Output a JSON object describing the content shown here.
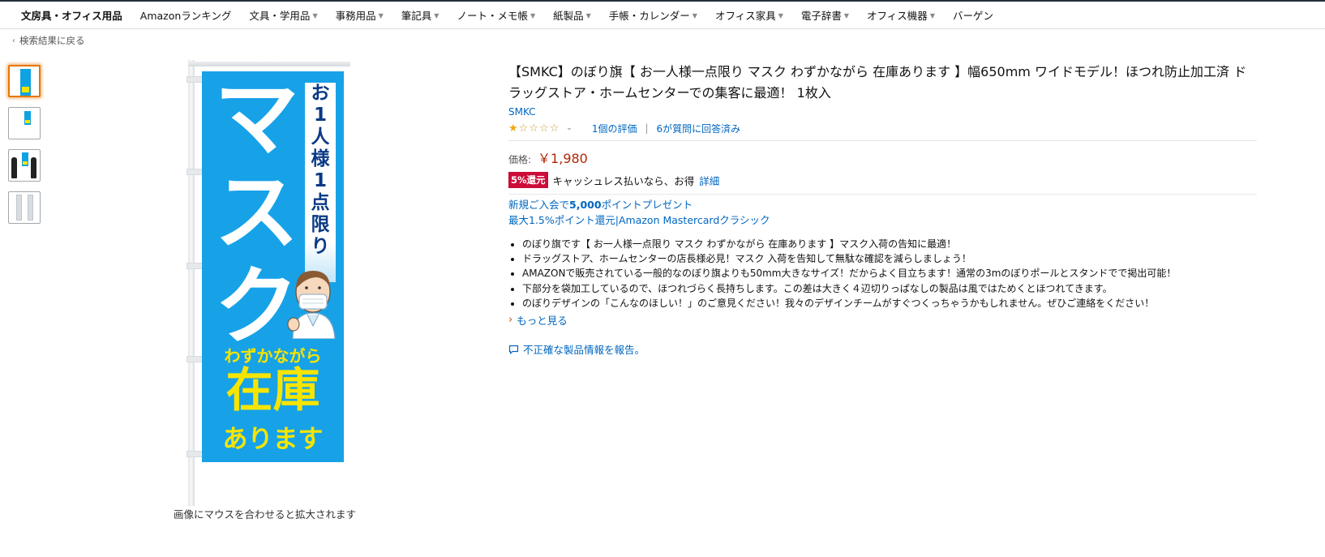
{
  "nav": {
    "items": [
      {
        "label": "文房具・オフィス用品",
        "dropdown": false,
        "bold": true
      },
      {
        "label": "Amazonランキング",
        "dropdown": false
      },
      {
        "label": "文具・学用品",
        "dropdown": true
      },
      {
        "label": "事務用品",
        "dropdown": true
      },
      {
        "label": "筆記具",
        "dropdown": true
      },
      {
        "label": "ノート・メモ帳",
        "dropdown": true
      },
      {
        "label": "紙製品",
        "dropdown": true
      },
      {
        "label": "手帳・カレンダー",
        "dropdown": true
      },
      {
        "label": "オフィス家具",
        "dropdown": true
      },
      {
        "label": "電子辞書",
        "dropdown": true
      },
      {
        "label": "オフィス機器",
        "dropdown": true
      },
      {
        "label": "バーゲン",
        "dropdown": false
      }
    ]
  },
  "back_link": "検索結果に戻る",
  "image": {
    "main_text": "マスク",
    "sub_text": "お1人様1点限り",
    "line1": "わずかながら",
    "line2": "在庫",
    "line3": "あります",
    "hover_hint": "画像にマウスを合わせると拡大されます"
  },
  "product": {
    "title": "【SMKC】のぼり旗【 お一人様一点限り マスク わずかながら 在庫あります 】幅650mm ワイドモデル！ほつれ防止加工済 ドラッグストア・ホームセンターでの集客に最適！ 1枚入",
    "brand": "SMKC",
    "rating_stars": 1,
    "rating_count": "1個の評価",
    "answered": "6が質問に回答済み",
    "price_label": "価格:",
    "price": "￥1,980",
    "promo_badge": "5%還元",
    "promo_text": "キャッシュレス払いなら、お得",
    "promo_link": "詳細",
    "points_line1_pre": "新規ご入会で",
    "points_line1_bold": "5,000",
    "points_line1_post": "ポイントプレゼント",
    "points_line2": "最大1.5%ポイント還元|Amazon Mastercardクラシック",
    "bullets": [
      "のぼり旗です【 お一人様一点限り マスク わずかながら 在庫あります 】マスク入荷の告知に最適！",
      "ドラッグストア、ホームセンターの店長様必見！マスク 入荷を告知して無駄な確認を減らしましょう！",
      "AMAZONで販売されている一般的なのぼり旗よりも50mm大きなサイズ！だからよく目立ちます！通常の3mのぼりポールとスタンドでで掲出可能！",
      "下部分を袋加工しているので、ほつれづらく長持ちします。この差は大きく４辺切りっぱなしの製品は風ではためくとほつれてきます。",
      "のぼりデザインの「こんなのほしい！」のご意見ください！我々のデザインチームがすぐつくっちゃうかもしれません。ぜひご連絡をください！"
    ],
    "see_more": "もっと見る",
    "report": "不正確な製品情報を報告。"
  },
  "colors": {
    "link": "#0066c0",
    "price": "#b12704",
    "badge": "#cc0c39",
    "flag_blue": "#17a2e8",
    "flag_yellow": "#f6e500",
    "selected_thumb": "#e77600"
  }
}
